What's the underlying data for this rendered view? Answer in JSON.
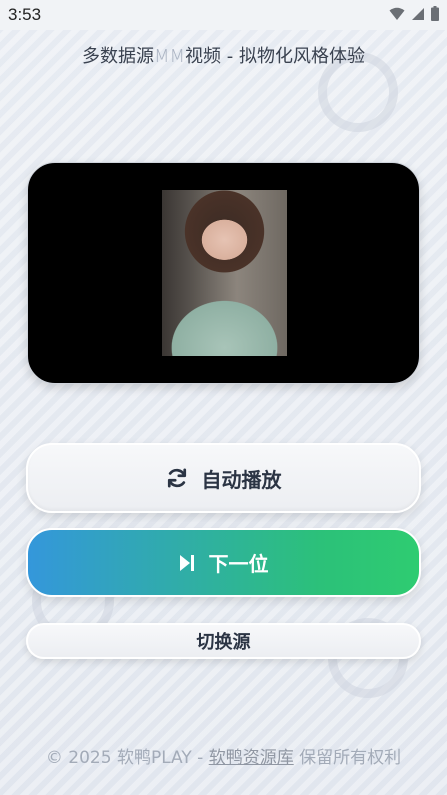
{
  "status_bar": {
    "time": "3:53"
  },
  "header": {
    "title_part1": "多数据源",
    "title_mm": "MM",
    "title_part2": "视频 - 拟物化风格体验"
  },
  "buttons": {
    "auto_play": "自动播放",
    "next": "下一位",
    "switch_source": "切换源"
  },
  "footer": {
    "prefix": "© 2025 软鸭PLAY - ",
    "link": "软鸭资源库",
    "suffix": " 保留所有权利"
  },
  "colors": {
    "gradient_start": "#3497db",
    "gradient_end": "#2ecc71",
    "text_dark": "#2b3444"
  },
  "icons": {
    "auto_play": "sync-icon",
    "next": "skip-forward-icon"
  }
}
